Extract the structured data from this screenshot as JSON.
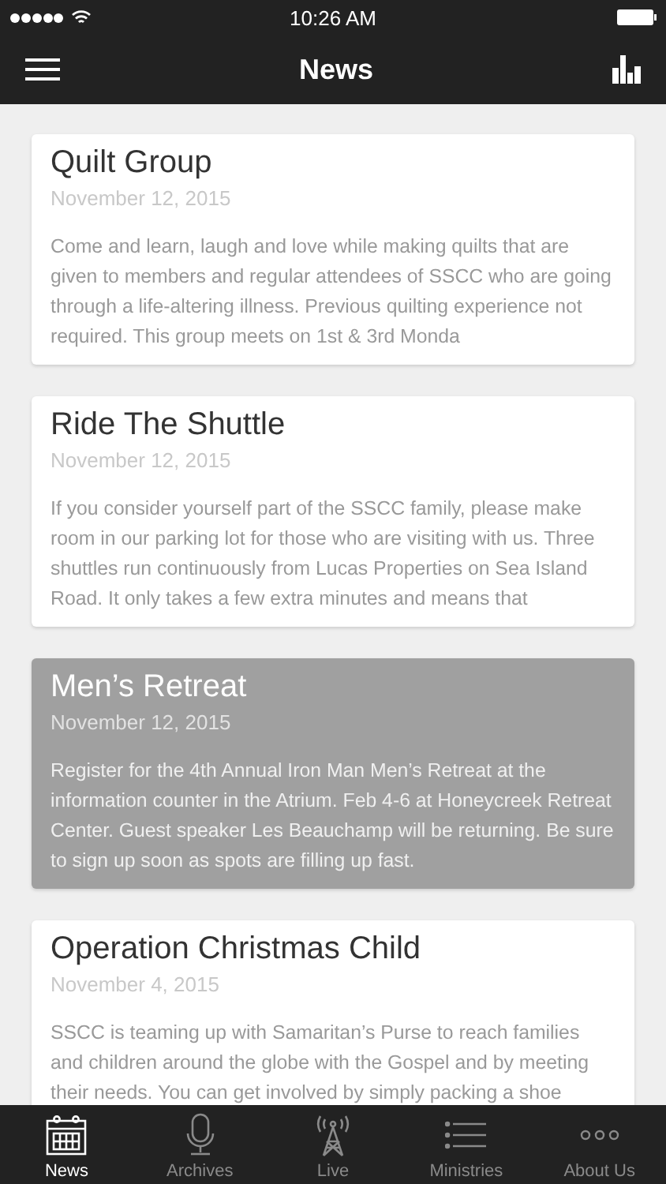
{
  "status_bar": {
    "time": "10:26 AM"
  },
  "nav_bar": {
    "title": "News"
  },
  "articles": [
    {
      "title": "Quilt Group",
      "date": "November 12, 2015",
      "body": "Come and learn, laugh and love while making quilts that are given to members and regular attendees of SSCC who are going through a life-altering illness. Previous quilting experience not required. This group meets on 1st & 3rd Monda",
      "selected": false
    },
    {
      "title": "Ride The Shuttle",
      "date": "November 12, 2015",
      "body": "If you consider yourself part of the SSCC family, please make room in our parking lot for those who are visiting with us. Three shuttles run continuously from Lucas Properties on Sea Island Road. It only takes a few extra minutes and means that",
      "selected": false
    },
    {
      "title": "Men’s Retreat",
      "date": "November 12, 2015",
      "body": "Register for the 4th Annual Iron Man Men’s Retreat at the information counter in the Atrium. Feb 4-6 at Honeycreek Retreat Center. Guest speaker Les Beauchamp will be returning. Be sure to sign up soon as spots are filling up fast.",
      "selected": true
    },
    {
      "title": "Operation Christmas Child",
      "date": "November 4, 2015",
      "body": "SSCC is teaming up with Samaritan’s Purse to reach families and children around the globe with the Gospel and by meeting their needs. You can get involved by simply packing a shoe",
      "selected": false
    }
  ],
  "tabs": [
    {
      "label": "News",
      "kind": "calendar",
      "selected": true
    },
    {
      "label": "Archives",
      "kind": "mic",
      "selected": false
    },
    {
      "label": "Live",
      "kind": "antenna",
      "selected": false
    },
    {
      "label": "Ministries",
      "kind": "list",
      "selected": false
    },
    {
      "label": "About Us",
      "kind": "more",
      "selected": false
    }
  ]
}
